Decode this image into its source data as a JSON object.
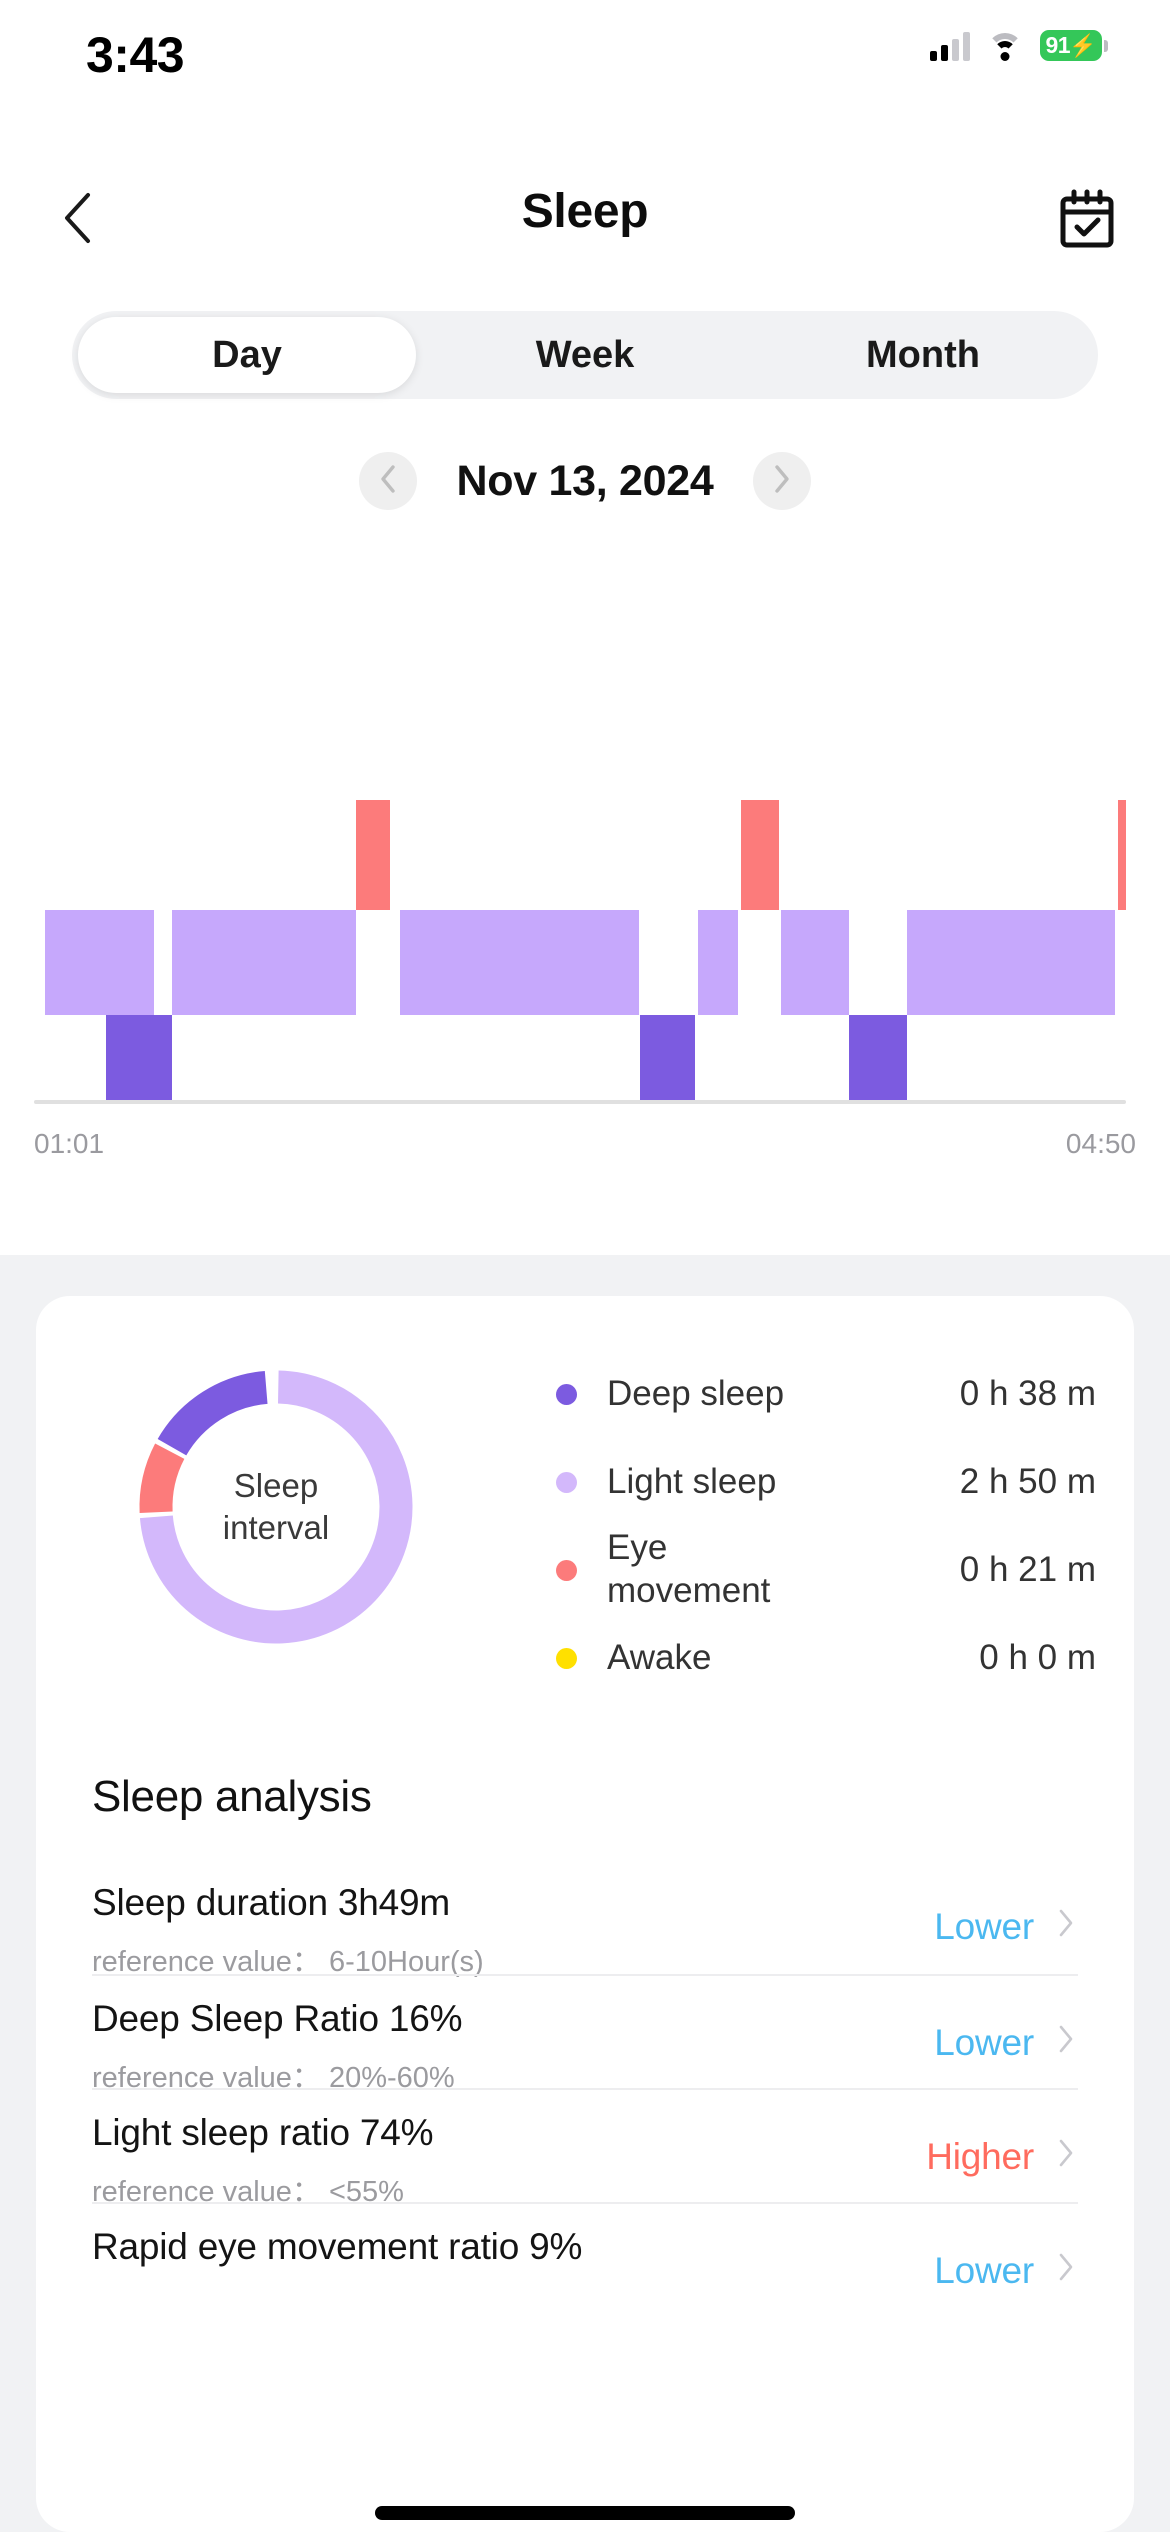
{
  "status_bar": {
    "time": "3:43",
    "battery_percent": "91",
    "battery_bolt": "⚡",
    "icons": [
      "cellular-signal-icon",
      "wifi-icon",
      "battery-icon"
    ],
    "battery_color": "#34C759"
  },
  "nav": {
    "back_icon": "chevron-left-icon",
    "title": "Sleep",
    "calendar_icon": "calendar-check-icon"
  },
  "tabs": {
    "items": [
      {
        "label": "Day",
        "active": true
      },
      {
        "label": "Week",
        "active": false
      },
      {
        "label": "Month",
        "active": false
      }
    ]
  },
  "date_nav": {
    "prev_icon": "chevron-left-icon",
    "next_icon": "chevron-right-icon",
    "date": "Nov 13, 2024"
  },
  "chart_data": {
    "type": "bar",
    "title": "Sleep stages hypnogram",
    "xlabel": "",
    "ylabel": "",
    "grid": false,
    "legend_position": "right",
    "x_axis": {
      "start_label": "01:01",
      "end_label": "04:50"
    },
    "stage_levels": [
      "Eye movement",
      "Light sleep",
      "Deep sleep"
    ],
    "colors": {
      "deep_sleep": "#7C5BE0",
      "light_sleep": "#C6A8FC",
      "eye_movement": "#FC7B7B",
      "awake": "#FFE000"
    },
    "segments": [
      {
        "stage": "Light sleep",
        "start_pct": 1.0,
        "end_pct": 11.0
      },
      {
        "stage": "Deep sleep",
        "start_pct": 6.6,
        "end_pct": 12.6
      },
      {
        "stage": "Light sleep",
        "start_pct": 12.6,
        "end_pct": 29.5
      },
      {
        "stage": "Eye movement",
        "start_pct": 29.5,
        "end_pct": 32.6
      },
      {
        "stage": "Light sleep",
        "start_pct": 33.5,
        "end_pct": 55.4
      },
      {
        "stage": "Deep sleep",
        "start_pct": 55.5,
        "end_pct": 60.5
      },
      {
        "stage": "Light sleep",
        "start_pct": 60.8,
        "end_pct": 64.5
      },
      {
        "stage": "Eye movement",
        "start_pct": 64.7,
        "end_pct": 68.2
      },
      {
        "stage": "Light sleep",
        "start_pct": 68.4,
        "end_pct": 74.6
      },
      {
        "stage": "Deep sleep",
        "start_pct": 74.6,
        "end_pct": 79.9
      },
      {
        "stage": "Light sleep",
        "start_pct": 79.9,
        "end_pct": 99.0
      },
      {
        "stage": "Eye movement",
        "start_pct": 99.3,
        "end_pct": 100.0
      }
    ]
  },
  "donut": {
    "center_line1": "Sleep",
    "center_line2": "interval",
    "slices": [
      {
        "name": "Light sleep",
        "percent": 74,
        "color": "#D3B8FB"
      },
      {
        "name": "Eye movement",
        "percent": 9,
        "color": "#FC7B7B"
      },
      {
        "name": "Deep sleep",
        "percent": 16,
        "color": "#7C5BE0"
      },
      {
        "name": "Awake",
        "percent": 0,
        "color": "#FFE000"
      }
    ]
  },
  "legend": {
    "items": [
      {
        "label": "Deep sleep",
        "value": "0 h 38 m",
        "color": "#7C5BE0",
        "dot": "deep-sleep-dot"
      },
      {
        "label": "Light sleep",
        "value": "2 h 50 m",
        "color": "#D3B8FB",
        "dot": "light-sleep-dot"
      },
      {
        "label": "Eye\nmovement",
        "value": "0 h 21 m",
        "color": "#FC7B7B",
        "dot": "eye-movement-dot"
      },
      {
        "label": "Awake",
        "value": "0 h 0 m",
        "color": "#FFE000",
        "dot": "awake-dot"
      }
    ]
  },
  "analysis": {
    "heading": "Sleep analysis",
    "status_colors": {
      "lower": "#4BB8F0",
      "higher": "#FF6B5E"
    },
    "rows": [
      {
        "title": "Sleep duration 3h49m",
        "reference": "reference value： 6-10Hour(s)",
        "status": "Lower",
        "status_kind": "lower"
      },
      {
        "title": "Deep Sleep Ratio 16%",
        "reference": "reference value： 20%-60%",
        "status": "Lower",
        "status_kind": "lower"
      },
      {
        "title": "Light sleep ratio 74%",
        "reference": "reference value： <55%",
        "status": "Higher",
        "status_kind": "higher"
      },
      {
        "title": "Rapid eye movement ratio 9%",
        "reference": "",
        "status": "Lower",
        "status_kind": "lower"
      }
    ]
  }
}
